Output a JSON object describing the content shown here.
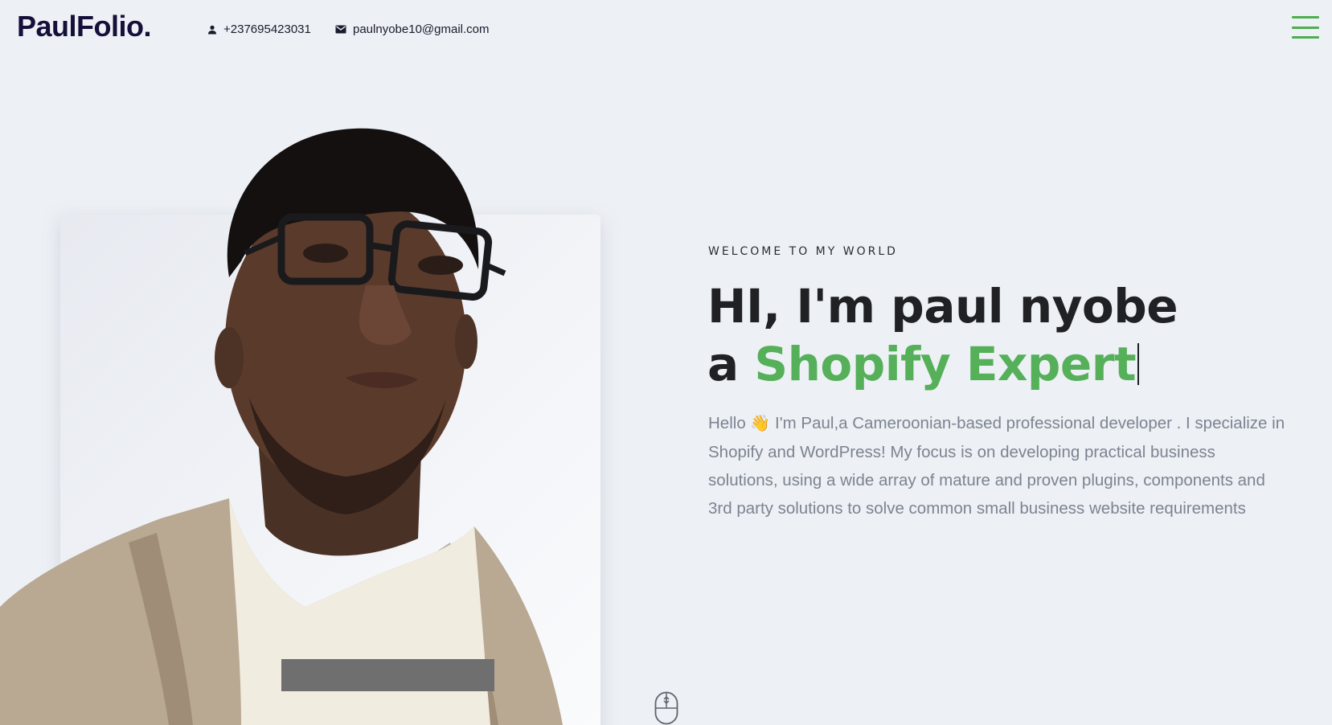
{
  "header": {
    "logo": "PaulFolio.",
    "phone": "+237695423031",
    "email": "paulnyobe10@gmail.com",
    "menu_icon": "hamburger-icon"
  },
  "hero": {
    "kicker": "WELCOME TO MY WORLD",
    "line1": "HI, I'm paul nyobe",
    "line2_prefix": "a",
    "line2_highlight": "Shopify Expert",
    "bio_hello": "Hello",
    "bio_emoji": "👋",
    "bio_text": "I'm Paul,a Cameroonian-based professional developer . I specialize in Shopify and WordPress! My focus is on developing practical business solutions, using a wide array of mature and proven plugins, components and 3rd party solutions to solve common small business website requirements"
  },
  "colors": {
    "accent": "#55b059",
    "background": "#edf0f4",
    "heading": "#1f2124",
    "logo": "#14103a"
  }
}
